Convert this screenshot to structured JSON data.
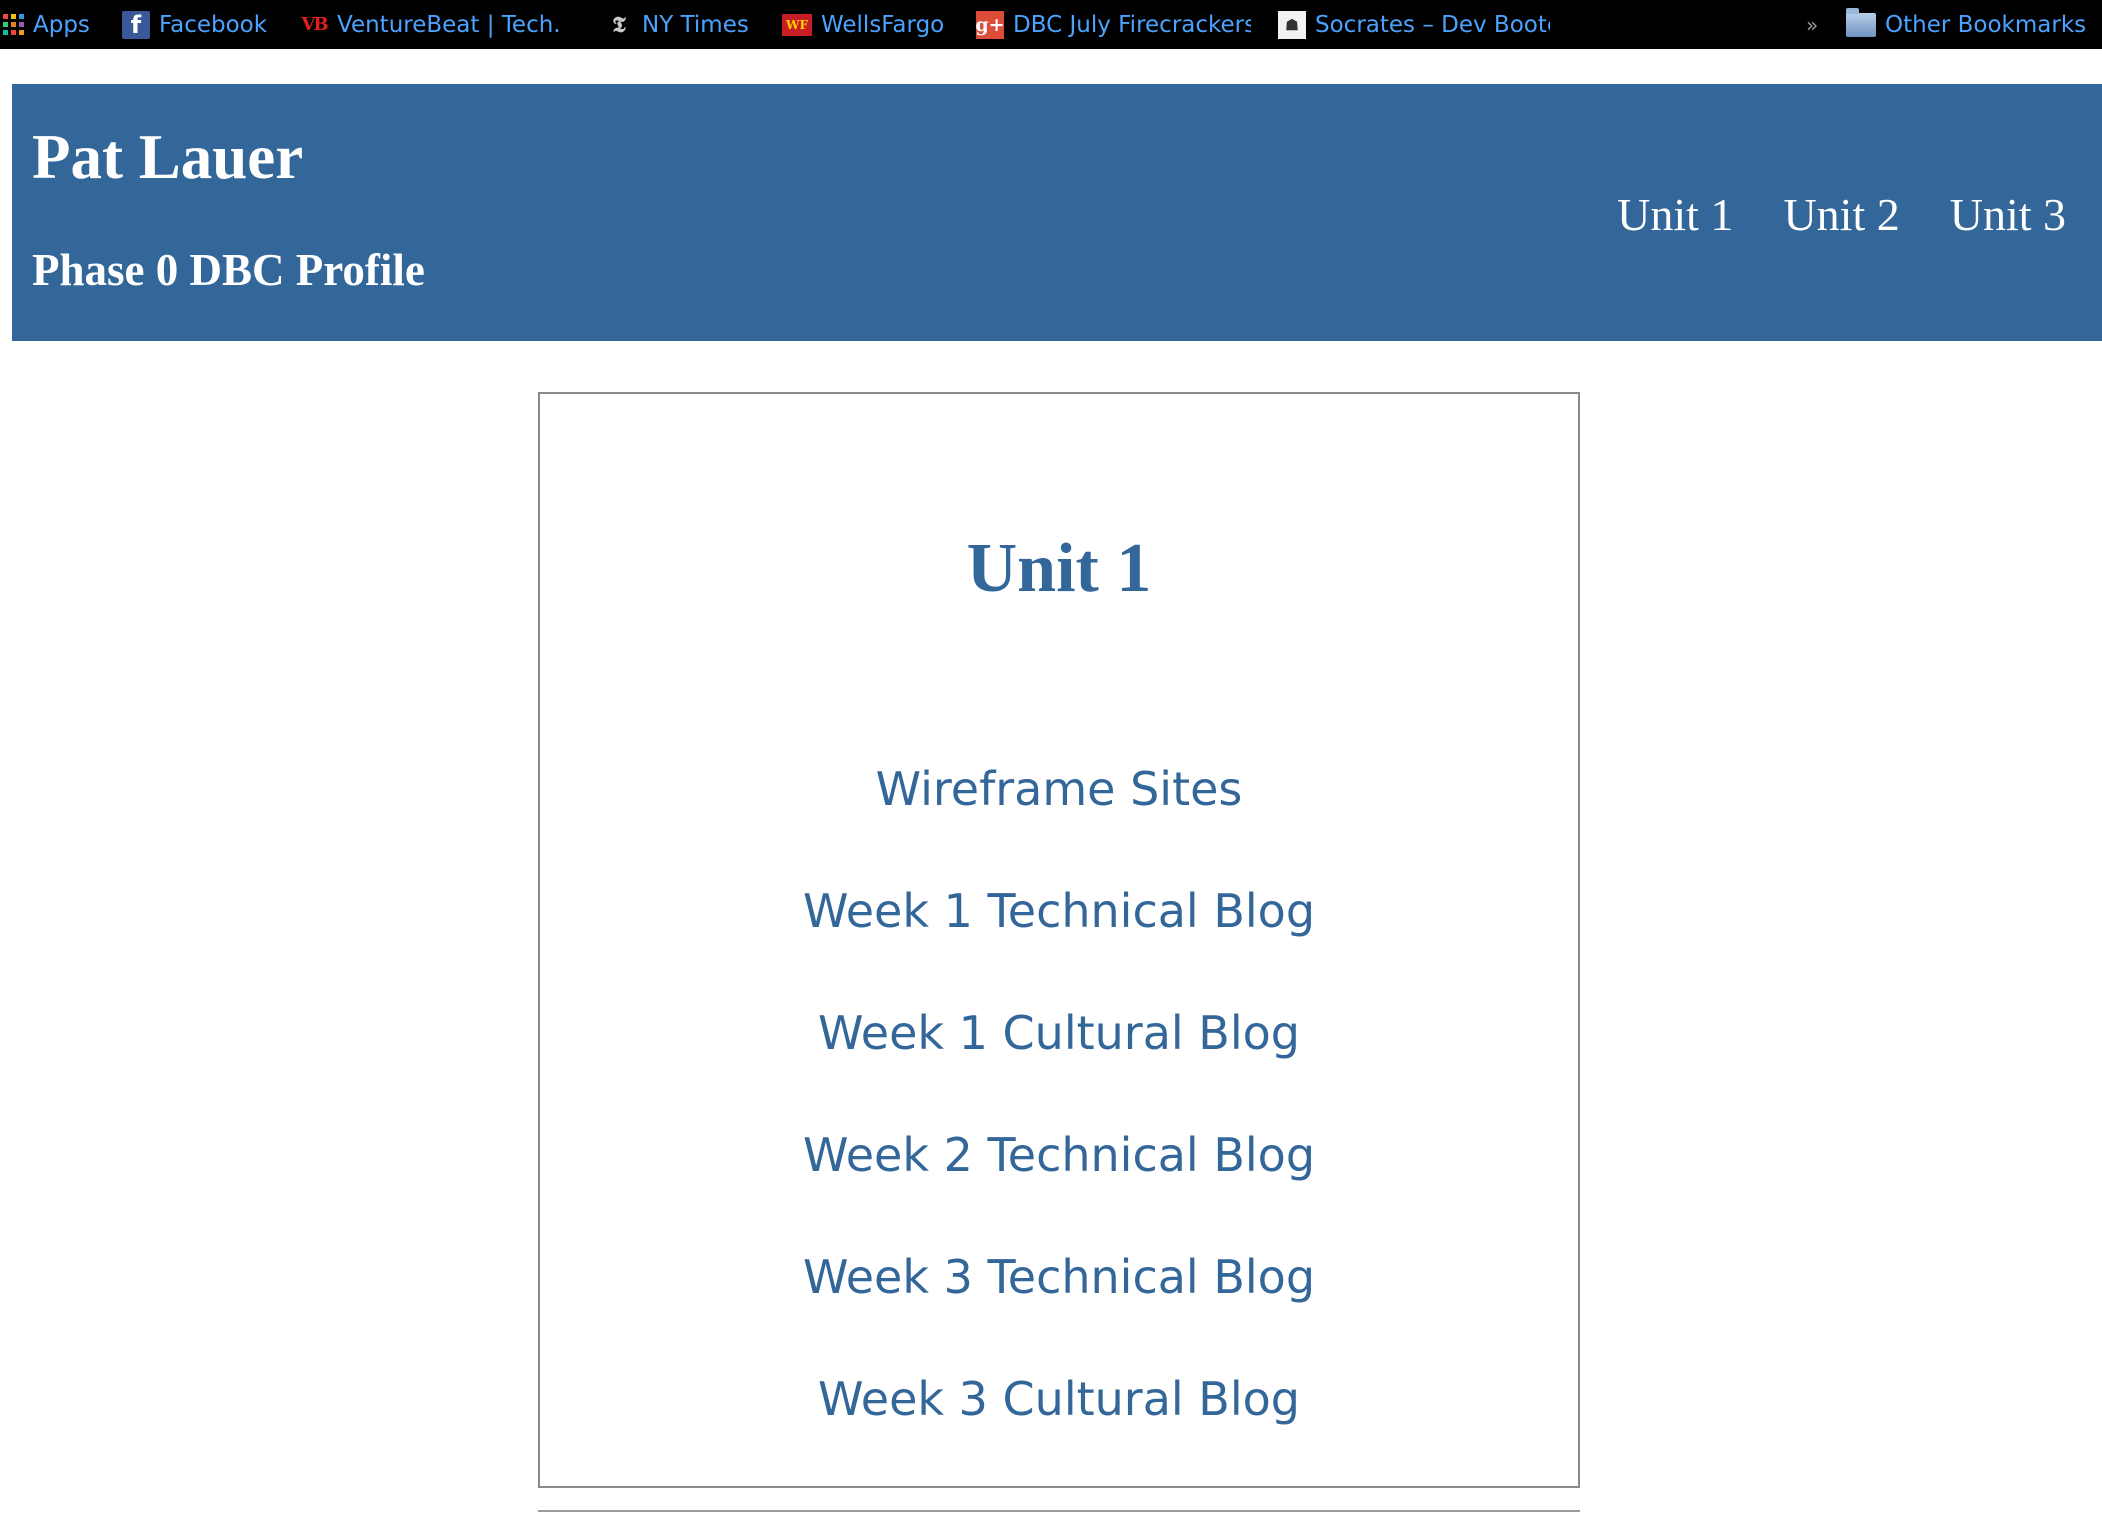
{
  "bookmarks": {
    "items": [
      {
        "label": "Apps",
        "icon": "apps-grid-icon"
      },
      {
        "label": "Facebook",
        "icon": "facebook-icon",
        "glyph": "f"
      },
      {
        "label": "VentureBeat | Tech.",
        "icon": "venturebeat-icon",
        "glyph": "VB"
      },
      {
        "label": "NY Times",
        "icon": "nytimes-icon",
        "glyph": "𝕿"
      },
      {
        "label": "WellsFargo",
        "icon": "wellsfargo-icon",
        "glyph": "WF"
      },
      {
        "label": "DBC July Firecrackers",
        "icon": "google-plus-icon",
        "glyph": "g+"
      },
      {
        "label": "Socrates – Dev Bootc",
        "icon": "socrates-icon",
        "glyph": "☗"
      }
    ],
    "more_glyph": "»",
    "other_label": "Other Bookmarks"
  },
  "header": {
    "title": "Pat Lauer",
    "subtitle": "Phase 0 DBC Profile",
    "nav": [
      "Unit 1",
      "Unit 2",
      "Unit 3"
    ]
  },
  "main": {
    "heading": "Unit 1",
    "links": [
      "Wireframe Sites",
      "Week 1 Technical Blog",
      "Week 1 Cultural Blog",
      "Week 2 Technical Blog",
      "Week 3 Technical Blog",
      "Week 3 Cultural Blog"
    ]
  },
  "colors": {
    "header_bg": "#336699",
    "link": "#336699",
    "bookmark_text": "#4aa3ff",
    "bookmark_bar_bg": "#000000"
  }
}
